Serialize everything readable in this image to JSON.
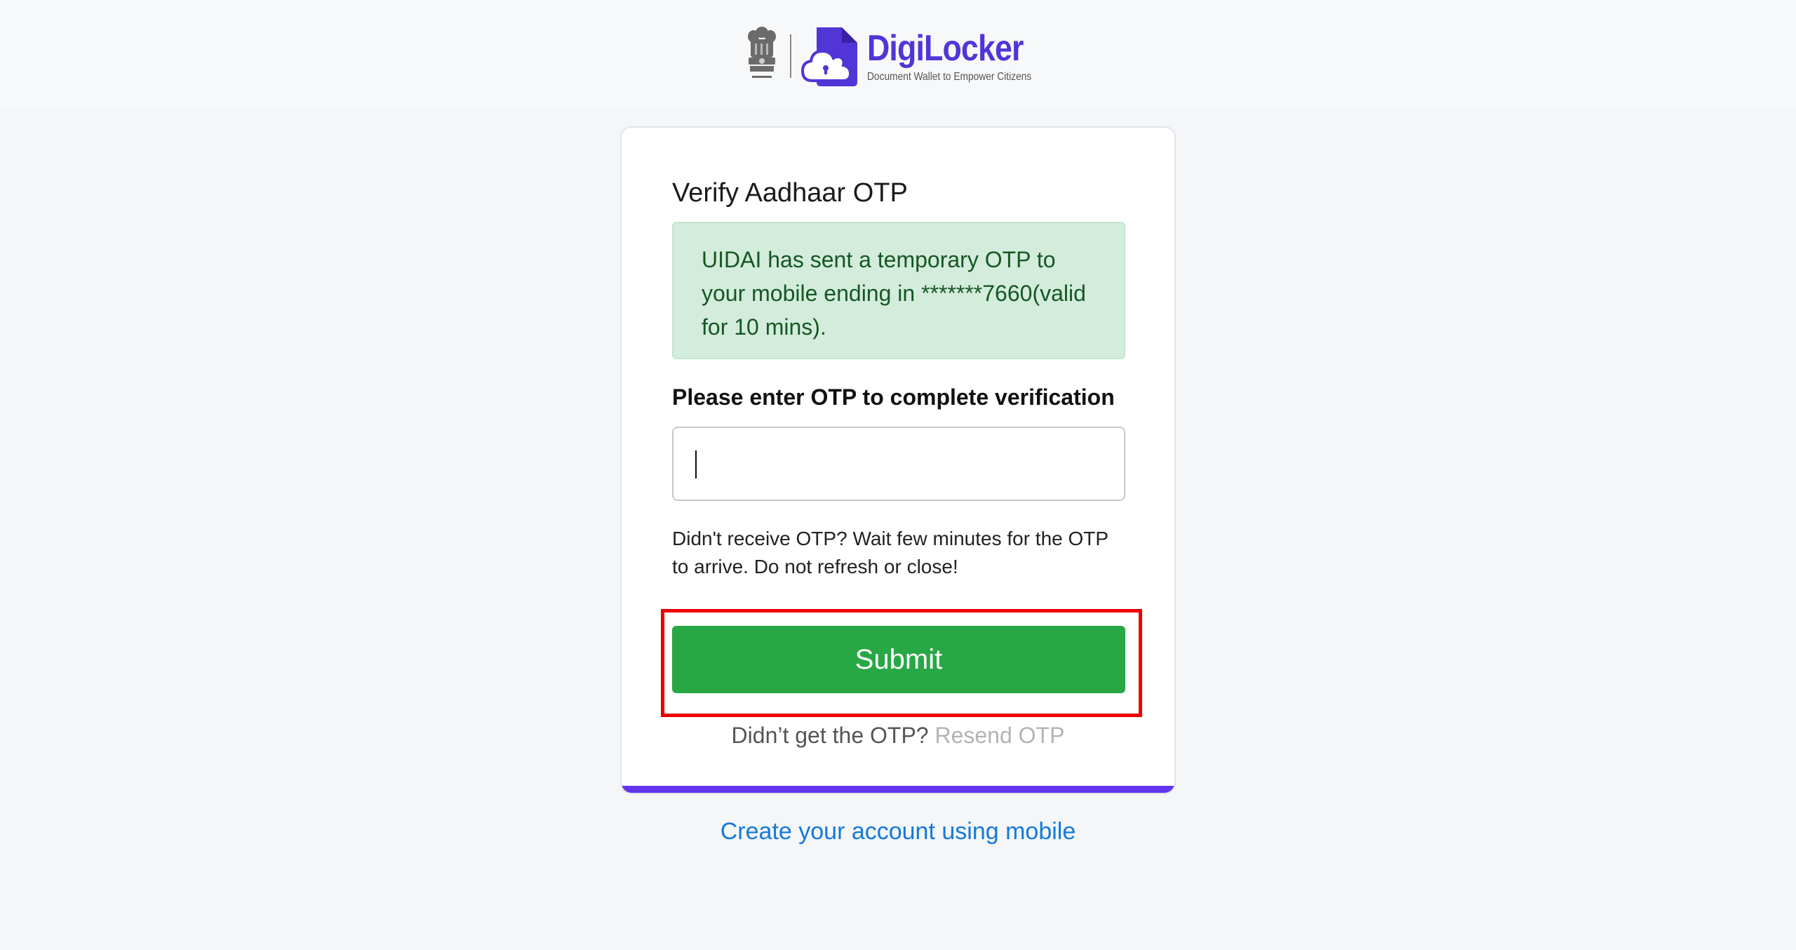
{
  "header": {
    "brand_name": "DigiLocker",
    "tagline": "Document Wallet to Empower Citizens",
    "brand_color": "#5235d6",
    "emblem_icon": "national-emblem-icon",
    "logo_icon": "cloud-lock-document-icon"
  },
  "card": {
    "title": "Verify Aadhaar OTP",
    "alert_message": "UIDAI has sent a temporary OTP to your mobile ending in *******7660(valid for 10 mins).",
    "otp_label": "Please enter OTP to complete verification",
    "otp_value": "",
    "hint": "Didn't receive OTP? Wait few minutes for the OTP to arrive. Do not refresh or close!",
    "submit_label": "Submit",
    "resend_prompt": "Didn’t get the OTP?",
    "resend_link": "Resend OTP",
    "accent_color": "#6236ee",
    "submit_color": "#28a745"
  },
  "footer": {
    "create_account_link": "Create your account using mobile"
  }
}
